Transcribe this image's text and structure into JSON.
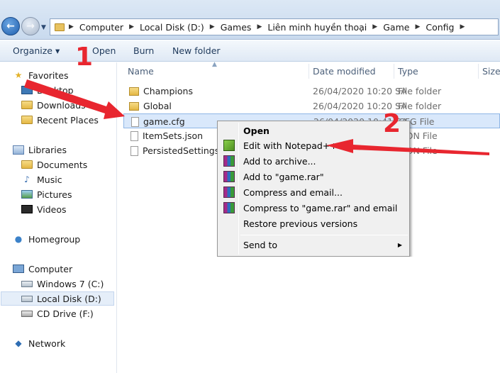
{
  "address": {
    "crumbs": [
      "Computer",
      "Local Disk (D:)",
      "Games",
      "Liên minh huyền thoại",
      "Game",
      "Config"
    ]
  },
  "toolbar": {
    "organize": "Organize ▾",
    "open": "Open",
    "burn": "Burn",
    "new_folder": "New folder"
  },
  "nav": {
    "favorites": "Favorites",
    "desktop": "Desktop",
    "downloads": "Downloads",
    "recent_places": "Recent Places",
    "libraries": "Libraries",
    "documents": "Documents",
    "music": "Music",
    "pictures": "Pictures",
    "videos": "Videos",
    "homegroup": "Homegroup",
    "computer": "Computer",
    "windows7": "Windows 7 (C:)",
    "local_disk": "Local Disk (D:)",
    "cd_drive": "CD Drive (F:)",
    "network": "Network"
  },
  "columns": {
    "name": "Name",
    "date_modified": "Date modified",
    "type": "Type",
    "size": "Size"
  },
  "files": [
    {
      "name": "Champions",
      "date": "26/04/2020 10:20 SA",
      "type": "File folder"
    },
    {
      "name": "Global",
      "date": "26/04/2020 10:20 SA",
      "type": "File folder"
    },
    {
      "name": "game.cfg",
      "date": "26/04/2020 10:41 SA",
      "type": "CFG File"
    },
    {
      "name": "ItemSets.json",
      "date": "",
      "type": "JSON File"
    },
    {
      "name": "PersistedSettings.json",
      "date": "",
      "type": "JSON File"
    }
  ],
  "context_menu": {
    "open": "Open",
    "edit_notepad": "Edit with Notepad++",
    "add_archive": "Add to archive...",
    "add_rar": "Add to \"game.rar\"",
    "compress_email": "Compress and email...",
    "compress_rar_email": "Compress to \"game.rar\" and email",
    "restore": "Restore previous versions",
    "send_to": "Send to"
  },
  "annotations": {
    "step1": "1",
    "step2": "2",
    "arrow_color": "#e8262f"
  }
}
